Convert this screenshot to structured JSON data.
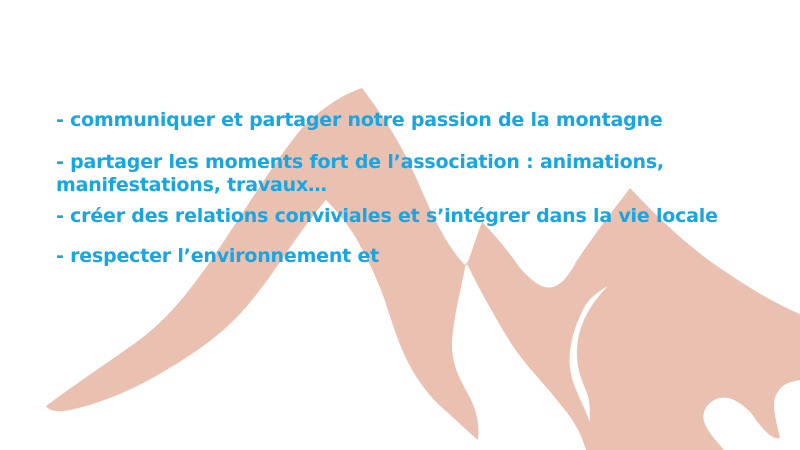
{
  "slide": {
    "bullets": [
      "- communiquer et partager notre passion de la montagne",
      "- partager les moments fort de l’association : animations, manifestations, travaux…",
      "- créer des relations conviviales et s’intégrer dans la vie locale",
      "- respecter l’environnement et"
    ],
    "text_color": "#16a6e3",
    "mountain_color": "#eac1b0"
  }
}
